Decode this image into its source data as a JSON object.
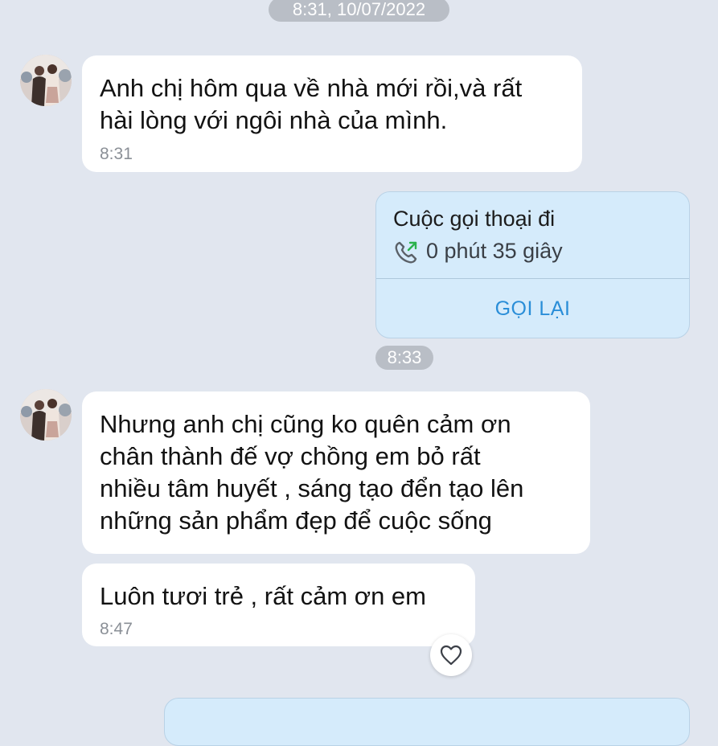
{
  "chat": {
    "top_stamp": "8:31, 10/07/2022",
    "message_1": {
      "text": "Anh chị hôm qua về nhà mới rồi,và rất\nhài lòng với ngôi nhà của mình.",
      "time": "8:31"
    },
    "call": {
      "title": "Cuộc gọi thoại đi",
      "duration": "0 phút 35 giây",
      "action": "GỌI LẠI",
      "icon": "outgoing-call-icon"
    },
    "stamp_2": "8:33",
    "message_2": {
      "text": "Nhưng anh chị cũng ko quên cảm ơn\nchân thành đế vợ chồng em bỏ rất\nnhiều tâm huyết , sáng tạo đển tạo lên\nnhững sản phẩm đẹp để cuộc sống"
    },
    "message_3": {
      "text": "Luôn tươi trẻ , rất cảm ơn em",
      "time": "8:47"
    },
    "reaction_icon": "heart-icon"
  },
  "colors": {
    "background": "#e1e6ef",
    "incoming_bubble": "#ffffff",
    "outgoing_bubble": "#d5ebfb",
    "accent": "#2a8ed8",
    "call_arrow": "#2bb24c"
  }
}
